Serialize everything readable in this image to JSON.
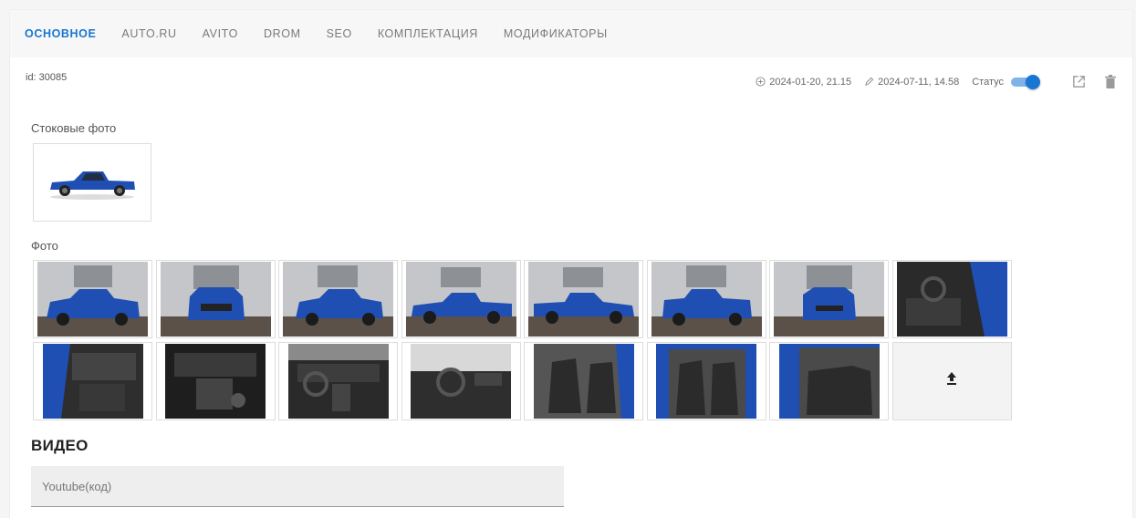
{
  "tabs": [
    {
      "label": "ОСНОВНОЕ",
      "active": true
    },
    {
      "label": "AUTO.RU",
      "active": false
    },
    {
      "label": "AVITO",
      "active": false
    },
    {
      "label": "DROM",
      "active": false
    },
    {
      "label": "SEO",
      "active": false
    },
    {
      "label": "КОМПЛЕКТАЦИЯ",
      "active": false
    },
    {
      "label": "МОДИФИКАТОРЫ",
      "active": false
    }
  ],
  "record": {
    "id_label": "id: 30085",
    "created": "2024-01-20, 21.15",
    "updated": "2024-07-11, 14.58",
    "status_label": "Статус",
    "status_on": true
  },
  "sections": {
    "stock_photos": "Стоковые фото",
    "photos": "Фото",
    "video": "ВИДЕО"
  },
  "video": {
    "placeholder": "Youtube(код)"
  },
  "photos": {
    "exterior_count": 7,
    "interior_count": 8
  },
  "colors": {
    "accent": "#1976d2",
    "car_blue": "#1f4fb3",
    "garage_wall": "#b9bcbf",
    "interior_dark": "#2a2a2a"
  },
  "icons": {
    "created": "plus-circle-icon",
    "updated": "pencil-icon",
    "open": "external-link-icon",
    "delete": "trash-icon",
    "upload": "upload-icon"
  }
}
